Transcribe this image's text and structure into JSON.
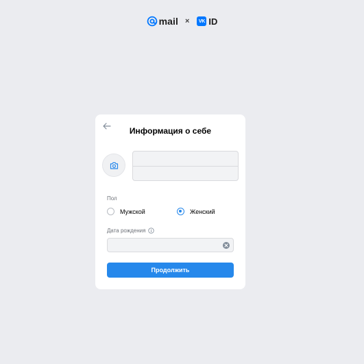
{
  "header": {
    "mail_logo_text": "mail",
    "separator": "×",
    "vk_box_text": "VK",
    "id_logo_text": "ID"
  },
  "form": {
    "title": "Информация о себе",
    "first_name": {
      "value": "",
      "placeholder": ""
    },
    "last_name": {
      "value": "",
      "placeholder": ""
    },
    "gender": {
      "label": "Пол",
      "options": [
        "Мужской",
        "Женский"
      ],
      "selected": "Женский"
    },
    "birth_date": {
      "label": "Дата рождения",
      "value": "",
      "placeholder": ""
    },
    "continue_label": "Продолжить"
  },
  "icons": {
    "back": "arrow-left-icon",
    "avatar": "camera-icon",
    "info": "info-icon",
    "clear": "clear-icon"
  },
  "colors": {
    "background": "#ebecf0",
    "card": "#ffffff",
    "accent": "#2688eb",
    "vk_brand": "#0077ff"
  }
}
